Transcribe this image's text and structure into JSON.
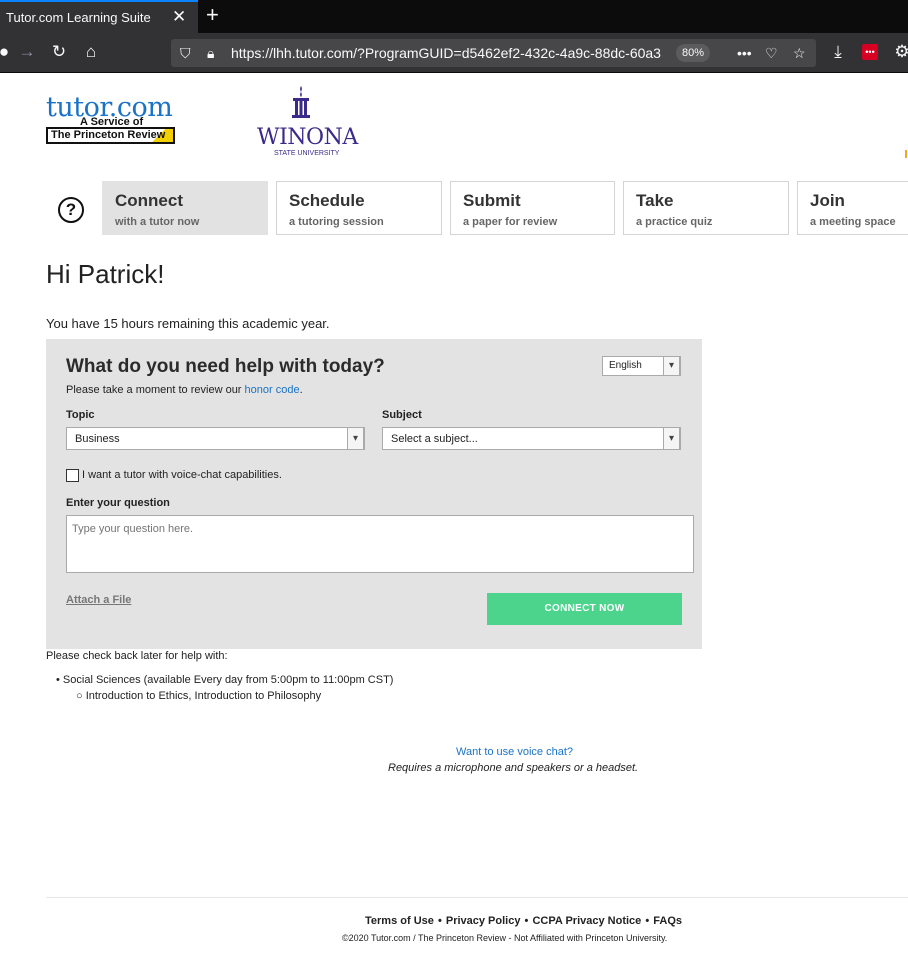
{
  "browser": {
    "tab_title": "Tutor.com Learning Suite",
    "url": "https://lhh.tutor.com/?ProgramGUID=d5462ef2-432c-4a9c-88dc-60a3",
    "zoom": "80%"
  },
  "logos": {
    "tutor": "tutor.com",
    "tutor_sub": "A Service of",
    "princeton": "The Princeton Review",
    "winona": "WINONA",
    "winona_sub": "STATE UNIVERSITY"
  },
  "nav": {
    "help": "?",
    "tabs": [
      {
        "title": "Connect",
        "sub": "with a tutor now"
      },
      {
        "title": "Schedule",
        "sub": "a tutoring session"
      },
      {
        "title": "Submit",
        "sub": "a paper for review"
      },
      {
        "title": "Take",
        "sub": "a practice quiz"
      },
      {
        "title": "Join",
        "sub": "a meeting space"
      }
    ]
  },
  "main": {
    "greeting": "Hi Patrick!",
    "remaining": "You have 15 hours remaining this academic year."
  },
  "panel": {
    "title": "What do you need help with today?",
    "language": "English",
    "honor_prefix": "Please take a moment to review our ",
    "honor_link": "honor code",
    "honor_suffix": ".",
    "topic_label": "Topic",
    "topic_value": "Business",
    "subject_label": "Subject",
    "subject_value": "Select a subject...",
    "voice_checkbox": "I want a tutor with voice-chat capabilities.",
    "question_label": "Enter your question",
    "question_placeholder": "Type your question here.",
    "attach": "Attach a File",
    "connect": "CONNECT NOW"
  },
  "availability": {
    "intro": "Please check back later for help with:",
    "item": "Social Sciences (available Every day from 5:00pm to 11:00pm CST)",
    "subitem": "Introduction to Ethics, Introduction to Philosophy"
  },
  "voice": {
    "link": "Want to use voice chat?",
    "note": "Requires a microphone and speakers or a headset."
  },
  "footer": {
    "links": [
      "Terms of Use",
      "Privacy Policy",
      "CCPA Privacy Notice",
      "FAQs"
    ],
    "separator": "•",
    "copyright": "©2020 Tutor.com / The Princeton Review - Not Affiliated with Princeton University."
  }
}
